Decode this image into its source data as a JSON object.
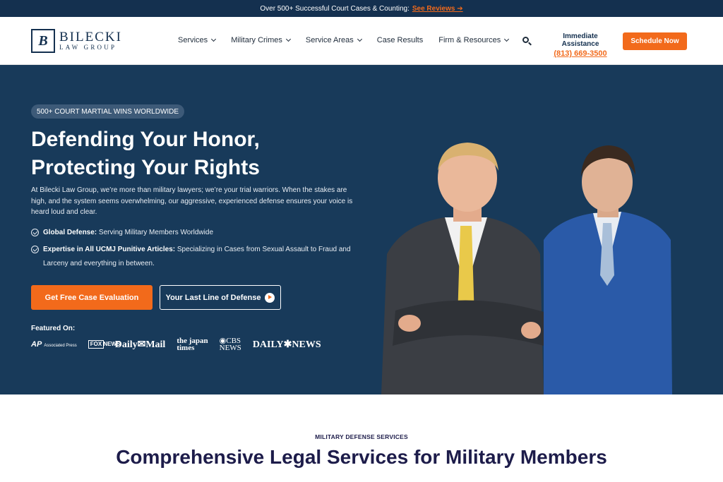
{
  "topbar": {
    "text": "Over 500+ Successful Court Cases & Counting:",
    "link": "See Reviews ➔"
  },
  "logo": {
    "mark": "B",
    "line1": "BILECKI",
    "line2": "LAW GROUP"
  },
  "nav": [
    {
      "label": "Services",
      "dropdown": true
    },
    {
      "label": "Military Crimes",
      "dropdown": true
    },
    {
      "label": "Service Areas",
      "dropdown": true
    },
    {
      "label": "Case Results",
      "dropdown": false
    },
    {
      "label": "Firm & Resources",
      "dropdown": true
    }
  ],
  "assist": {
    "title": "Immediate Assistance",
    "phone": "(813) 669-3500"
  },
  "schedule_label": "Schedule Now",
  "hero": {
    "badge": "500+ COURT MARTIAL WINS WORLDWIDE",
    "headline_line1": "Defending Your Honor,",
    "headline_line2": "Protecting Your Rights",
    "lead": "At Bilecki Law Group, we’re more than military lawyers; we’re your trial warriors. When the stakes are high, and the system seems overwhelming, our aggressive, experienced defense ensures your voice is heard loud and clear.",
    "bullet1_bold": "Global Defense:",
    "bullet1_text": " Serving Military Members Worldwide",
    "bullet2_bold": "Expertise in All UCMJ Punitive Articles:",
    "bullet2_text": " Specializing in Cases from Sexual Assault to Fraud and Larceny and everything in between.",
    "cta_primary": "Get Free Case Evaluation",
    "cta_secondary": "Your Last Line of Defense",
    "featured_label": "Featured On:",
    "press": {
      "ap": "AP",
      "ap_sub": "Associated Press",
      "fox": "FOX NEWS",
      "dailymail": "Daily✉Mail",
      "japantimes_1": "the japan",
      "japantimes_2": "times",
      "cbs_1": "◉CBS",
      "cbs_2": "NEWS",
      "dailynews": "DAILY✱NEWS"
    }
  },
  "services": {
    "eyebrow": "MILITARY DEFENSE SERVICES",
    "title": "Comprehensive Legal Services for Military Members"
  },
  "colors": {
    "navy": "#183a5a",
    "topbar": "#14304f",
    "accent": "#f26a1b",
    "title": "#1d1c4a"
  },
  "icons": [
    "chevron-down-icon",
    "search-icon",
    "check-circle-icon",
    "play-icon"
  ]
}
